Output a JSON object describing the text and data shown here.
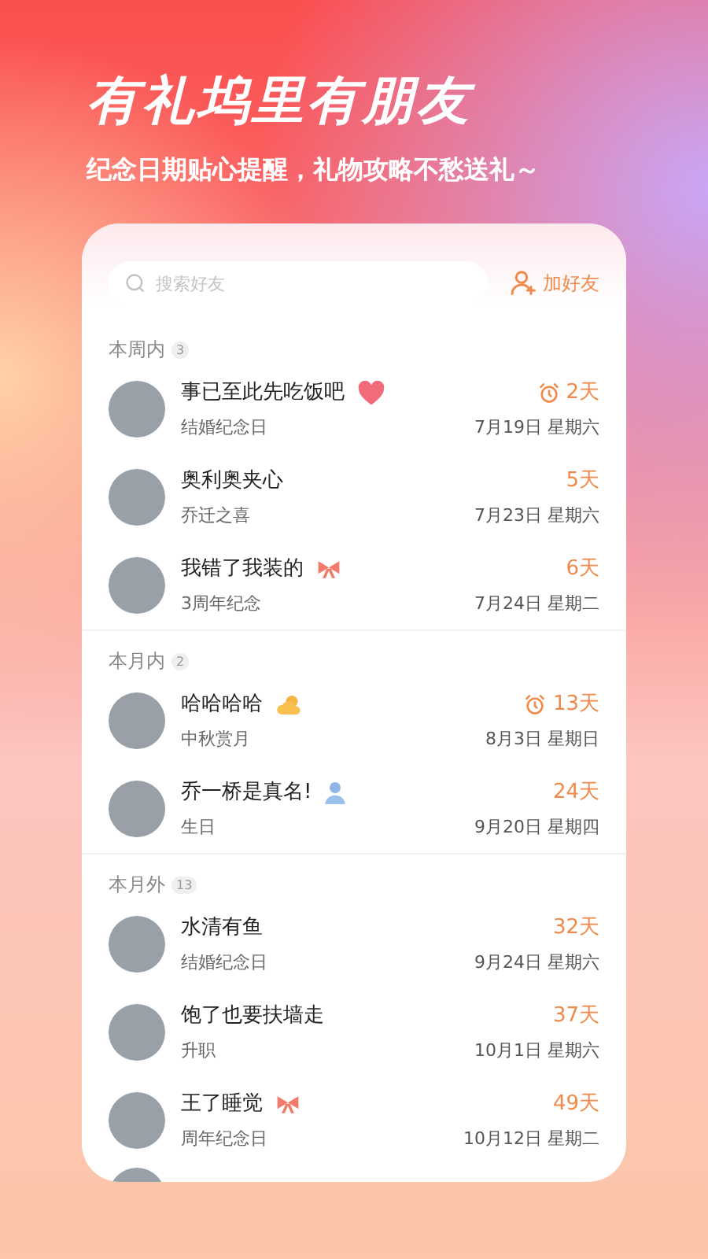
{
  "headline": "有礼坞里有朋友",
  "subtitle": "纪念日期贴心提醒，礼物攻略不愁送礼～",
  "search": {
    "placeholder": "搜索好友"
  },
  "add_friend": "加好友",
  "sections": [
    {
      "title": "本周内",
      "count": "3",
      "friends": [
        {
          "name": "事已至此先吃饭吧",
          "kind": "heart",
          "occasion": "结婚纪念日",
          "alarm": true,
          "days": "2天",
          "date": "7月19日 星期六"
        },
        {
          "name": "奥利奥夹心",
          "kind": "plain",
          "occasion": "乔迁之喜",
          "alarm": false,
          "days": "5天",
          "date": "7月23日 星期六"
        },
        {
          "name": "我错了我装的",
          "kind": "bow",
          "occasion": "3周年纪念",
          "alarm": false,
          "days": "6天",
          "date": "7月24日 星期二"
        }
      ]
    },
    {
      "title": "本月内",
      "count": "2",
      "friends": [
        {
          "name": "哈哈哈哈",
          "kind": "cloud",
          "occasion": "中秋赏月",
          "alarm": true,
          "days": "13天",
          "date": "8月3日 星期日"
        },
        {
          "name": "乔一桥是真名!",
          "kind": "person",
          "occasion": "生日",
          "alarm": false,
          "days": "24天",
          "date": "9月20日 星期四"
        }
      ]
    },
    {
      "title": "本月外",
      "count": "13",
      "friends": [
        {
          "name": "水清有鱼",
          "kind": "plain",
          "occasion": "结婚纪念日",
          "alarm": false,
          "days": "32天",
          "date": "9月24日 星期六"
        },
        {
          "name": "饱了也要扶墙走",
          "kind": "plain",
          "occasion": "升职",
          "alarm": false,
          "days": "37天",
          "date": "10月1日 星期六"
        },
        {
          "name": "王了睡觉",
          "kind": "bow",
          "occasion": "周年纪念日",
          "alarm": false,
          "days": "49天",
          "date": "10月12日 星期二"
        }
      ]
    }
  ]
}
